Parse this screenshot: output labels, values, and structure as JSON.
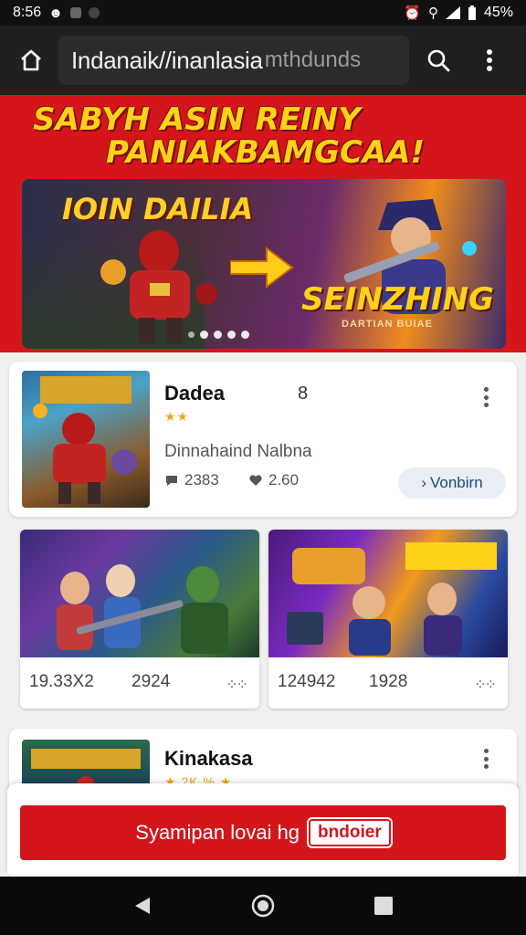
{
  "status_bar": {
    "time": "8:56",
    "battery": "45%"
  },
  "browser": {
    "url": "Indanaik//inanlasia",
    "url_faded": "mthdunds"
  },
  "promo": {
    "headline_line1": "SABYH ASIN REINY",
    "headline_line2": "PANIAKBAMGCAA!"
  },
  "banner": {
    "left_title": "IOIN DAILIA",
    "right_title": "SEINZHING",
    "right_subtitle": "DARTIAN BUIAE",
    "dot_count": 5
  },
  "featured_card": {
    "title": "Dadea",
    "number": "8",
    "rating_stars": 2,
    "description": "Dinnahaind Nalbna",
    "stat_comments": "2383",
    "stat_likes": "2.60",
    "view_button": "Vonbirn"
  },
  "tiles": [
    {
      "stat1": "19.33X2",
      "stat2": "2924"
    },
    {
      "stat1": "124942",
      "stat2": "1928"
    }
  ],
  "second_card": {
    "title": "Kinakasa",
    "meta": "2K %"
  },
  "cta": {
    "label": "Syamipan lovai hg",
    "badge": "bndoier"
  },
  "colors": {
    "brand_red": "#d4161c",
    "headline_yellow": "#ffd21a",
    "star_orange": "#f0a81c"
  }
}
